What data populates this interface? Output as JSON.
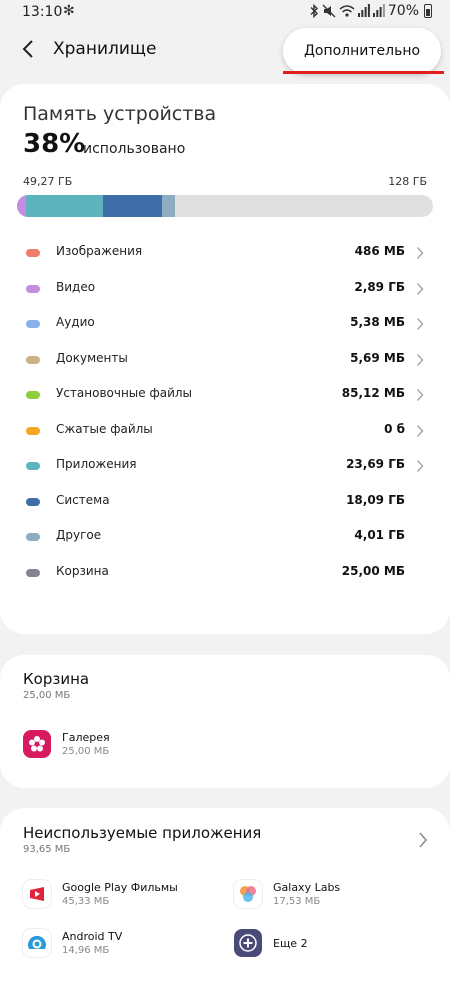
{
  "status": {
    "time": "13:10",
    "battery": "70%"
  },
  "header": {
    "title": "Хранилище",
    "more_button": "Дополнительно"
  },
  "storage": {
    "title": "Память устройства",
    "percent": "38%",
    "used_label": "использовано",
    "used": "49,27 ГБ",
    "total": "128 ГБ",
    "bar_segments": [
      {
        "name": "Видео",
        "fraction": 0.022,
        "color": "#c38ee0"
      },
      {
        "name": "Приложения",
        "fraction": 0.185,
        "color": "#5db4bf"
      },
      {
        "name": "Система",
        "fraction": 0.141,
        "color": "#3e6da8"
      },
      {
        "name": "Другое",
        "fraction": 0.031,
        "color": "#8eadc2"
      }
    ],
    "categories": [
      {
        "label": "Изображения",
        "value": "486 МБ",
        "color": "#ef7d6e",
        "chevron": true
      },
      {
        "label": "Видео",
        "value": "2,89 ГБ",
        "color": "#c38ee0",
        "chevron": true
      },
      {
        "label": "Аудио",
        "value": "5,38 МБ",
        "color": "#88b0ea",
        "chevron": true
      },
      {
        "label": "Документы",
        "value": "5,69 МБ",
        "color": "#cdb08a",
        "chevron": true
      },
      {
        "label": "Установочные файлы",
        "value": "85,12 МБ",
        "color": "#8fce3a",
        "chevron": true
      },
      {
        "label": "Сжатые файлы",
        "value": "0 б",
        "color": "#f5a623",
        "chevron": true
      },
      {
        "label": "Приложения",
        "value": "23,69 ГБ",
        "color": "#5db4bf",
        "chevron": true
      },
      {
        "label": "Система",
        "value": "18,09 ГБ",
        "color": "#3e6da8",
        "chevron": false
      },
      {
        "label": "Другое",
        "value": "4,01 ГБ",
        "color": "#8eadc2",
        "chevron": false
      },
      {
        "label": "Корзина",
        "value": "25,00 МБ",
        "color": "#838393",
        "chevron": false
      }
    ]
  },
  "trash": {
    "title": "Корзина",
    "size": "25,00 МБ",
    "apps": [
      {
        "name": "Галерея",
        "size": "25,00 МБ",
        "icon": "gallery-icon"
      }
    ]
  },
  "unused": {
    "title": "Неиспользуемые приложения",
    "size": "93,65 МБ",
    "apps": [
      {
        "name": "Google Play Фильмы",
        "size": "45,33 МБ",
        "icon": "play-movies-icon"
      },
      {
        "name": "Galaxy Labs",
        "size": "17,53 МБ",
        "icon": "galaxy-labs-icon"
      },
      {
        "name": "Android TV",
        "size": "14,96 МБ",
        "icon": "android-tv-icon"
      },
      {
        "name": "Еще 2",
        "size": "",
        "icon": "more-apps-icon"
      }
    ]
  }
}
